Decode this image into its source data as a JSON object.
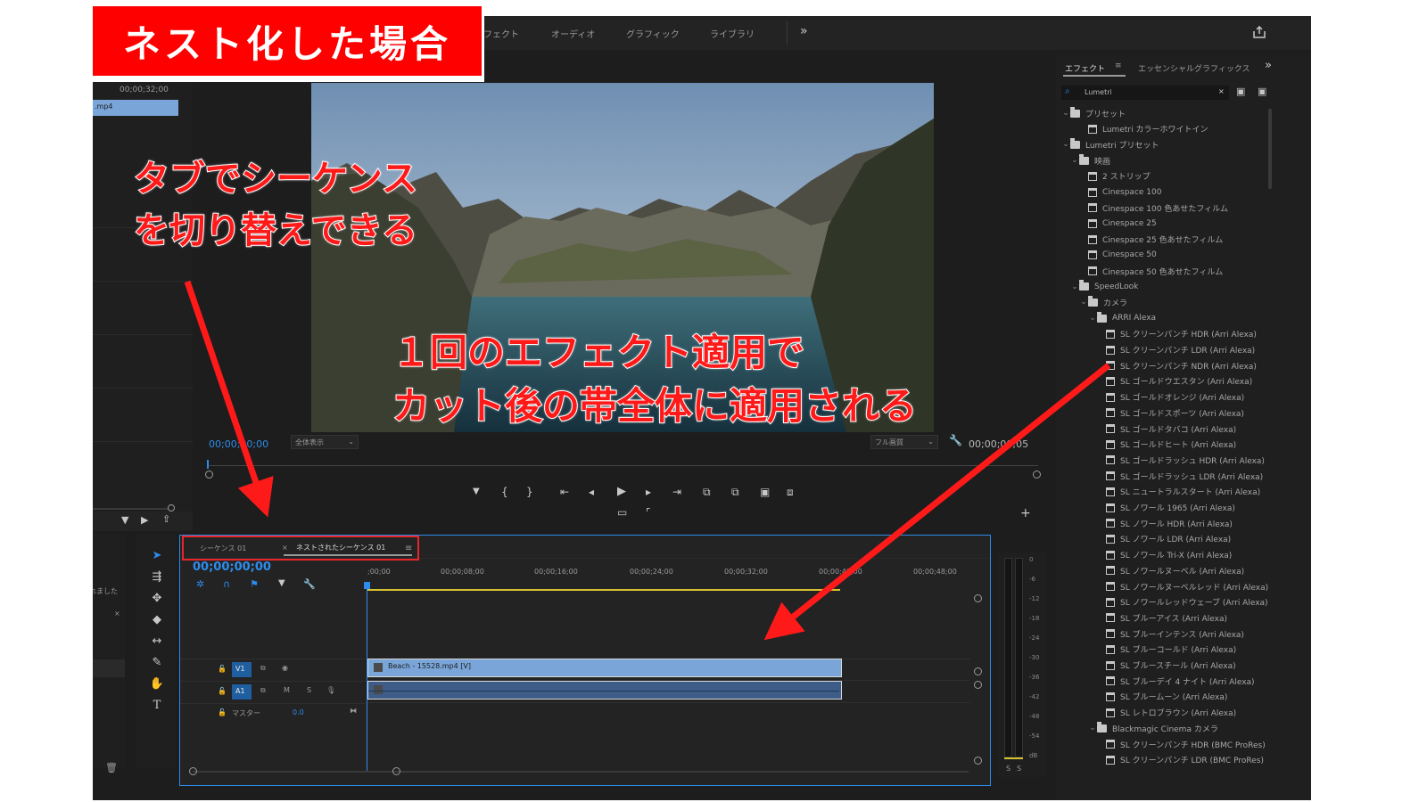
{
  "banner": {
    "title": "ネスト化した場合"
  },
  "annotations": {
    "left_line1": "タブでシーケンス",
    "left_line2": "を切り替えできる",
    "center_line1": "１回のエフェクト適用で",
    "center_line2": "カット後の帯全体に適用される"
  },
  "header": {
    "tabs": [
      "フェクト",
      "オーディオ",
      "グラフィック",
      "ライブラリ"
    ],
    "more": "»"
  },
  "project_panel": {
    "timecode": "00;00;32;00",
    "clip_name": ".mp4",
    "side_text": "れました"
  },
  "program_monitor": {
    "timecode_left": "00;00;00;00",
    "fit_select": "全体表示",
    "quality_select": "フル画質",
    "timecode_right": "00;00;00;05"
  },
  "timeline": {
    "tabs": [
      {
        "label": "シーケンス 01",
        "active": false
      },
      {
        "label": "ネストされたシーケンス 01",
        "active": true
      }
    ],
    "close_glyph": "×",
    "menu_glyph": "≡",
    "playhead_time": "00;00;00;00",
    "ruler_labels": [
      ";00;00",
      "00;00;08;00",
      "00;00;16;00",
      "00;00;24;00",
      "00;00;32;00",
      "00;00;40;00",
      "00;00;48;00"
    ],
    "tracks": {
      "v1": "V1",
      "a1": "A1",
      "m": "M",
      "s": "S",
      "master_label": "マスター",
      "master_value": "0.0"
    },
    "clip_label": "Beach - 15528.mp4 [V]"
  },
  "audio_meter": {
    "labels": [
      "0",
      "-6",
      "-12",
      "-18",
      "-24",
      "-30",
      "-36",
      "-42",
      "-48",
      "-54",
      "dB"
    ],
    "solo": [
      "S",
      "S"
    ]
  },
  "effects_panel": {
    "tab_effects": "エフェクト",
    "tab_menu": "≡",
    "tab_essential": "エッセンシャルグラフィックス",
    "more": "»",
    "search_value": "Lumetri",
    "clear_glyph": "×",
    "tree": [
      {
        "depth": 0,
        "kind": "folder",
        "label": "プリセット"
      },
      {
        "depth": 1,
        "kind": "preset",
        "label": "Lumetri カラーホワイトイン"
      },
      {
        "depth": 0,
        "kind": "folder",
        "label": "Lumetri プリセット"
      },
      {
        "depth": 1,
        "kind": "folder",
        "label": "映画"
      },
      {
        "depth": 2,
        "kind": "preset",
        "label": "2 ストリップ"
      },
      {
        "depth": 2,
        "kind": "preset",
        "label": "Cinespace 100"
      },
      {
        "depth": 2,
        "kind": "preset",
        "label": "Cinespace 100 色あせたフィルム"
      },
      {
        "depth": 2,
        "kind": "preset",
        "label": "Cinespace 25"
      },
      {
        "depth": 2,
        "kind": "preset",
        "label": "Cinespace 25 色あせたフィルム"
      },
      {
        "depth": 2,
        "kind": "preset",
        "label": "Cinespace 50"
      },
      {
        "depth": 2,
        "kind": "preset",
        "label": "Cinespace 50 色あせたフィルム"
      },
      {
        "depth": 1,
        "kind": "folder",
        "label": "SpeedLook"
      },
      {
        "depth": 2,
        "kind": "folder",
        "label": "カメラ"
      },
      {
        "depth": 3,
        "kind": "folder",
        "label": "ARRI Alexa"
      },
      {
        "depth": 4,
        "kind": "preset",
        "label": "SL クリーンパンチ HDR (Arri Alexa)"
      },
      {
        "depth": 4,
        "kind": "preset",
        "label": "SL クリーンパンチ LDR (Arri Alexa)"
      },
      {
        "depth": 4,
        "kind": "preset",
        "label": "SL クリーンパンチ NDR (Arri Alexa)"
      },
      {
        "depth": 4,
        "kind": "preset",
        "label": "SL ゴールドウエスタン (Arri Alexa)"
      },
      {
        "depth": 4,
        "kind": "preset",
        "label": "SL ゴールドオレンジ (Arri Alexa)"
      },
      {
        "depth": 4,
        "kind": "preset",
        "label": "SL ゴールドスポーツ (Arri Alexa)"
      },
      {
        "depth": 4,
        "kind": "preset",
        "label": "SL ゴールドタバコ (Arri Alexa)"
      },
      {
        "depth": 4,
        "kind": "preset",
        "label": "SL ゴールドヒート (Arri Alexa)"
      },
      {
        "depth": 4,
        "kind": "preset",
        "label": "SL ゴールドラッシュ HDR (Arri Alexa)"
      },
      {
        "depth": 4,
        "kind": "preset",
        "label": "SL ゴールドラッシュ LDR (Arri Alexa)"
      },
      {
        "depth": 4,
        "kind": "preset",
        "label": "SL ニュートラルスタート (Arri Alexa)"
      },
      {
        "depth": 4,
        "kind": "preset",
        "label": "SL ノワール 1965 (Arri Alexa)"
      },
      {
        "depth": 4,
        "kind": "preset",
        "label": "SL ノワール HDR (Arri Alexa)"
      },
      {
        "depth": 4,
        "kind": "preset",
        "label": "SL ノワール LDR (Arri Alexa)"
      },
      {
        "depth": 4,
        "kind": "preset",
        "label": "SL ノワール Tri-X (Arri Alexa)"
      },
      {
        "depth": 4,
        "kind": "preset",
        "label": "SL ノワールヌーベル (Arri Alexa)"
      },
      {
        "depth": 4,
        "kind": "preset",
        "label": "SL ノワールヌーベルレッド (Arri Alexa)"
      },
      {
        "depth": 4,
        "kind": "preset",
        "label": "SL ノワールレッドウェーブ (Arri Alexa)"
      },
      {
        "depth": 4,
        "kind": "preset",
        "label": "SL ブルーアイス (Arri Alexa)"
      },
      {
        "depth": 4,
        "kind": "preset",
        "label": "SL ブルーインテンス (Arri Alexa)"
      },
      {
        "depth": 4,
        "kind": "preset",
        "label": "SL ブルーコールド (Arri Alexa)"
      },
      {
        "depth": 4,
        "kind": "preset",
        "label": "SL ブルースチール (Arri Alexa)"
      },
      {
        "depth": 4,
        "kind": "preset",
        "label": "SL ブルーデイ 4 ナイト (Arri Alexa)"
      },
      {
        "depth": 4,
        "kind": "preset",
        "label": "SL ブルームーン (Arri Alexa)"
      },
      {
        "depth": 4,
        "kind": "preset",
        "label": "SL レトロブラウン (Arri Alexa)"
      },
      {
        "depth": 3,
        "kind": "folder",
        "label": "Blackmagic Cinema カメラ"
      },
      {
        "depth": 4,
        "kind": "preset",
        "label": "SL クリーンパンチ HDR (BMC ProRes)"
      },
      {
        "depth": 4,
        "kind": "preset",
        "label": "SL クリーンパンチ LDR (BMC ProRes)"
      }
    ]
  },
  "colors": {
    "accent_blue": "#2d8ceb",
    "clip_blue": "#7aa5d8",
    "annotation_red": "#ff1a1a",
    "highlight_box": "#e8262c"
  }
}
